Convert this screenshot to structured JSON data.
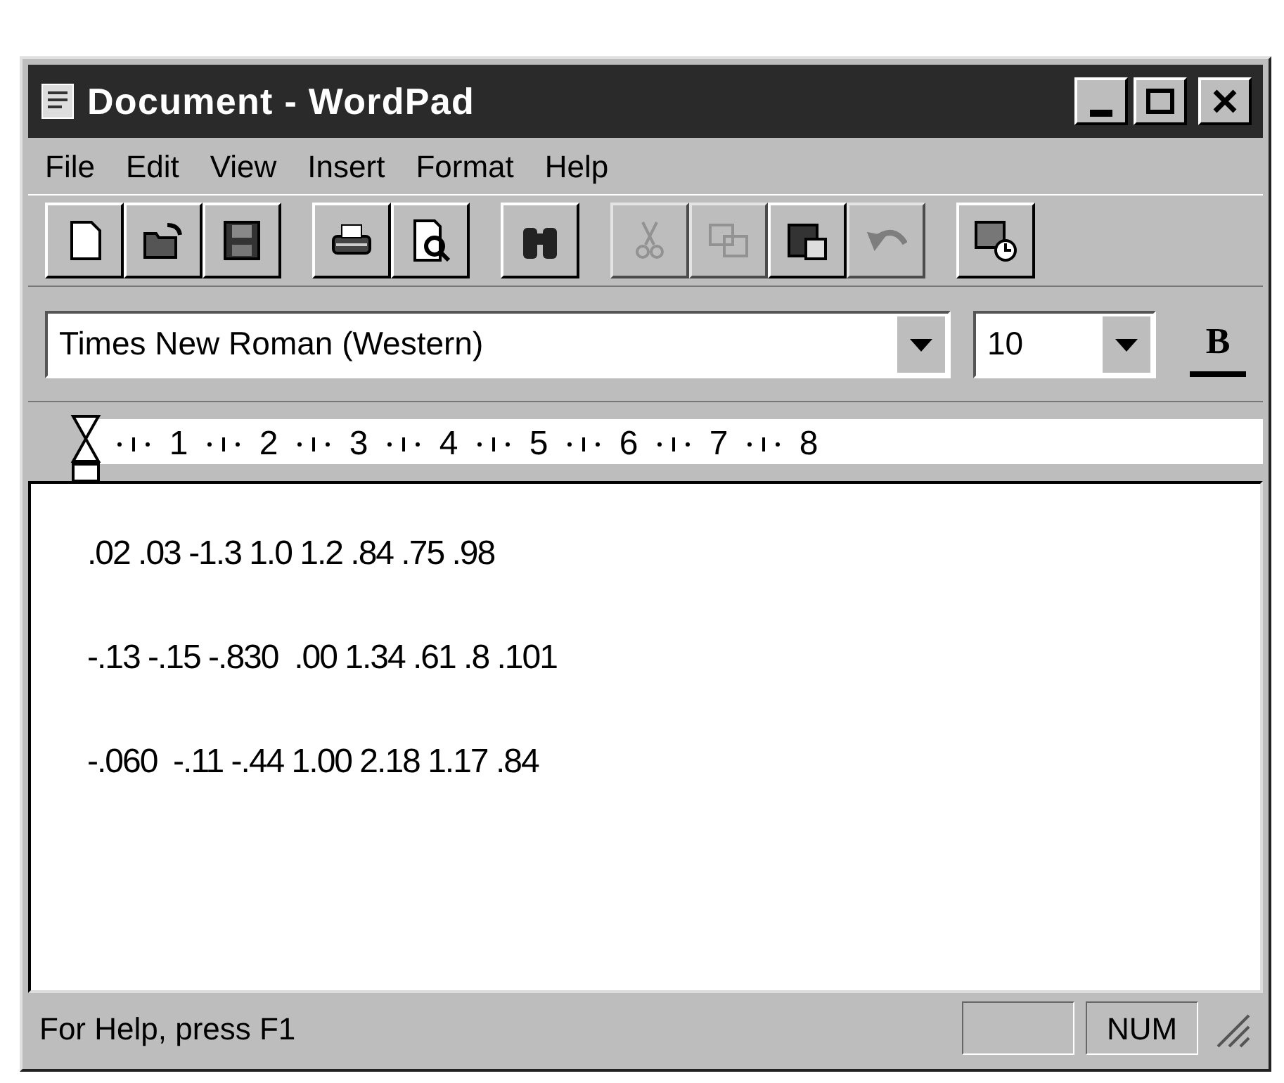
{
  "window": {
    "title": "Document - WordPad"
  },
  "menu": [
    "File",
    "Edit",
    "View",
    "Insert",
    "Format",
    "Help"
  ],
  "toolbar": [
    [
      {
        "kind": "new",
        "disabled": false
      },
      {
        "kind": "open",
        "disabled": false
      },
      {
        "kind": "save",
        "disabled": false
      }
    ],
    [
      {
        "kind": "print",
        "disabled": false
      },
      {
        "kind": "preview",
        "disabled": false
      }
    ],
    [
      {
        "kind": "find",
        "disabled": false
      }
    ],
    [
      {
        "kind": "cut",
        "disabled": true
      },
      {
        "kind": "copy",
        "disabled": true
      },
      {
        "kind": "paste",
        "disabled": false
      },
      {
        "kind": "undo",
        "disabled": true
      }
    ],
    [
      {
        "kind": "datetime",
        "disabled": false
      }
    ]
  ],
  "format_bar": {
    "font": "Times New Roman (Western)",
    "size": "10",
    "bold": "B"
  },
  "ruler": [
    "1",
    "2",
    "3",
    "4",
    "5",
    "6",
    "7",
    "8"
  ],
  "document": {
    "lines": [
      ".02 .03 -1.3 1.0 1.2 .84 .75 .98",
      "-.13 -.15 -.830  .00 1.34 .61 .8 .101",
      "-.060  -.11 -.44 1.00 2.18 1.17 .84"
    ]
  },
  "status_bar": {
    "message": "For Help, press F1",
    "num": "NUM"
  }
}
